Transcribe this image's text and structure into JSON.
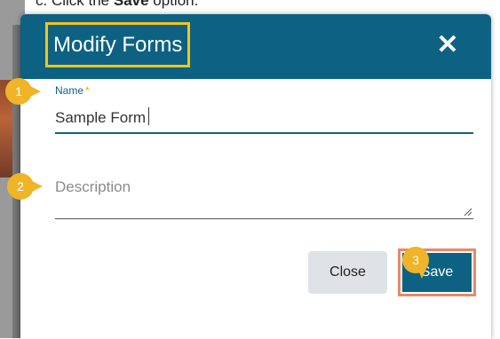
{
  "caption": {
    "prefix": "c.  Click the ",
    "bold": "Save",
    "suffix": " option."
  },
  "modal": {
    "title": "Modify Forms",
    "close_icon": "close-icon"
  },
  "name_field": {
    "label": "Name",
    "required_marker": "*",
    "value": "Sample Form"
  },
  "description_field": {
    "placeholder": "Description",
    "value": ""
  },
  "buttons": {
    "close_label": "Close",
    "save_label": "Save"
  },
  "steps": {
    "one": "1",
    "two": "2",
    "three": "3"
  },
  "colors": {
    "header": "#0d6283",
    "title_highlight": "#f5c518",
    "step_badge": "#f0b429",
    "save_highlight": "#e8886b"
  }
}
